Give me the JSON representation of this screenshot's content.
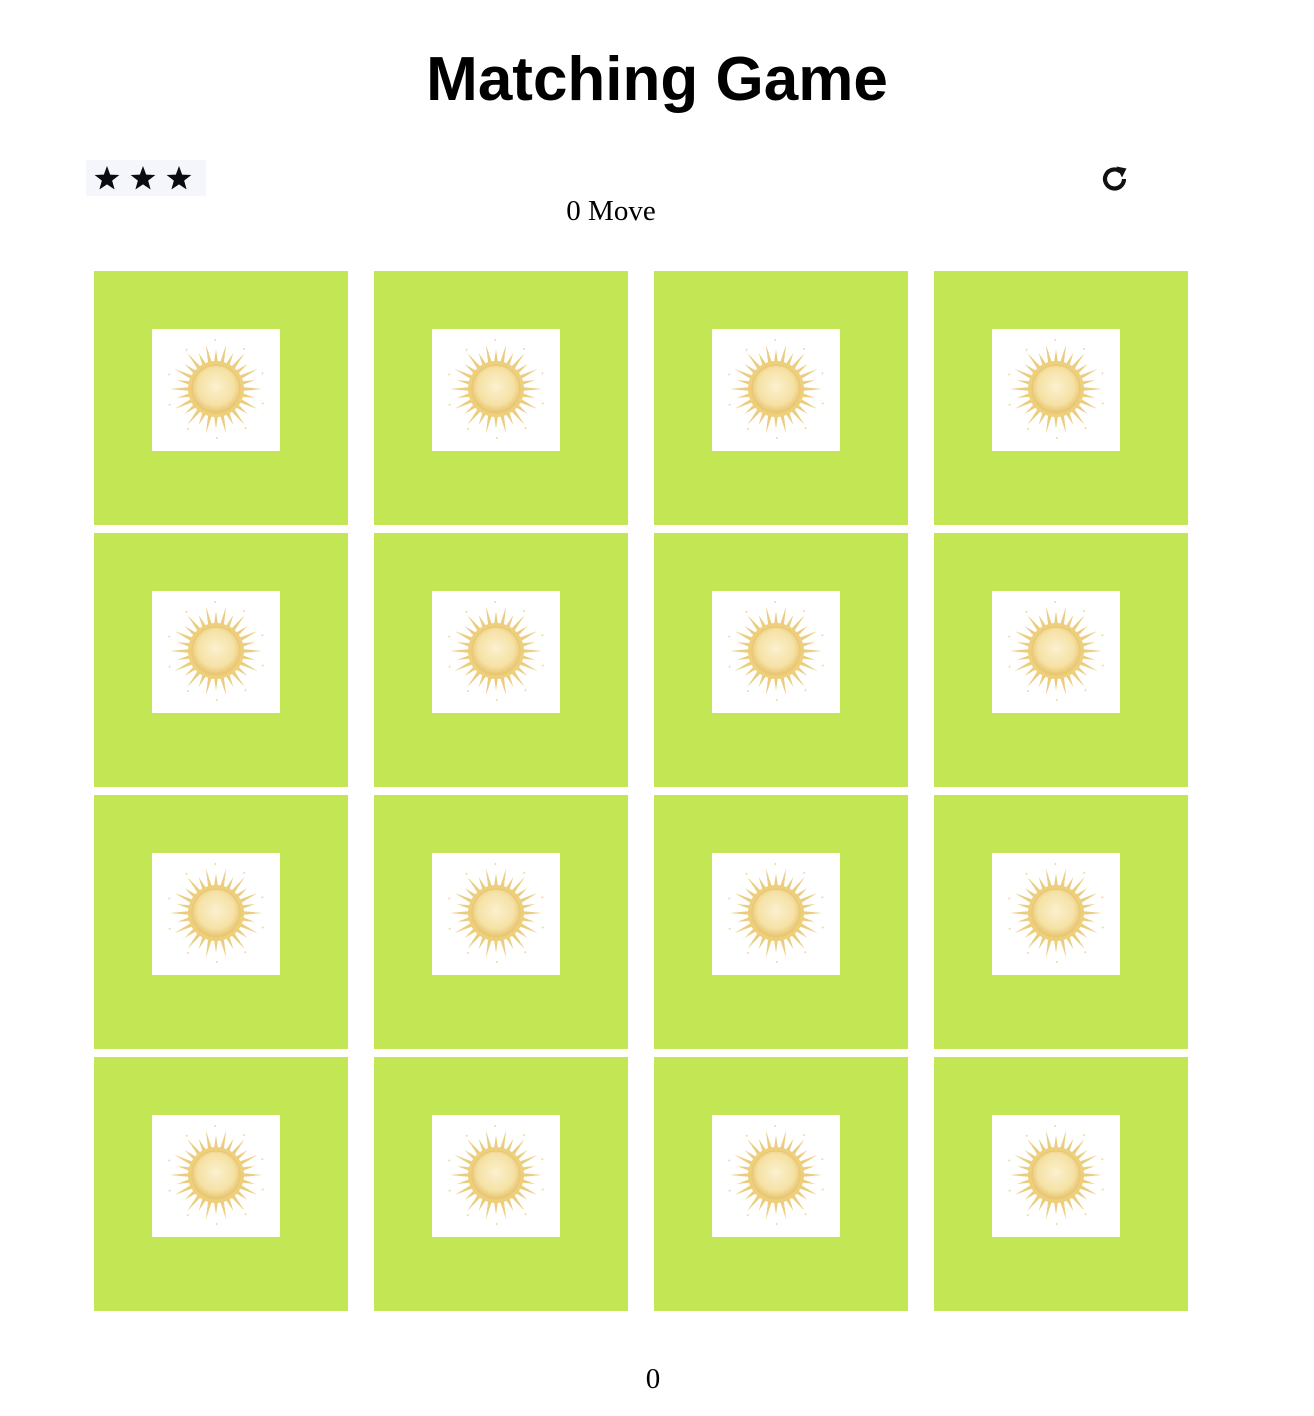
{
  "header": {
    "title": "Matching Game"
  },
  "score_panel": {
    "stars_count": 3,
    "star_icon": "star-icon",
    "moves_text": "0 Move",
    "restart_icon": "restart-icon"
  },
  "deck": {
    "card_color": "#c3e655",
    "card_icon": "sun-icon",
    "rows": 4,
    "columns": 4,
    "cards": [
      {
        "state": "face-up",
        "symbol": "sun"
      },
      {
        "state": "face-up",
        "symbol": "sun"
      },
      {
        "state": "face-up",
        "symbol": "sun"
      },
      {
        "state": "face-up",
        "symbol": "sun"
      },
      {
        "state": "face-up",
        "symbol": "sun"
      },
      {
        "state": "face-up",
        "symbol": "sun"
      },
      {
        "state": "face-up",
        "symbol": "sun"
      },
      {
        "state": "face-up",
        "symbol": "sun"
      },
      {
        "state": "face-up",
        "symbol": "sun"
      },
      {
        "state": "face-up",
        "symbol": "sun"
      },
      {
        "state": "face-up",
        "symbol": "sun"
      },
      {
        "state": "face-up",
        "symbol": "sun"
      },
      {
        "state": "face-up",
        "symbol": "sun"
      },
      {
        "state": "face-up",
        "symbol": "sun"
      },
      {
        "state": "face-up",
        "symbol": "sun"
      },
      {
        "state": "face-up",
        "symbol": "sun"
      }
    ]
  },
  "timer": {
    "value": "0"
  }
}
